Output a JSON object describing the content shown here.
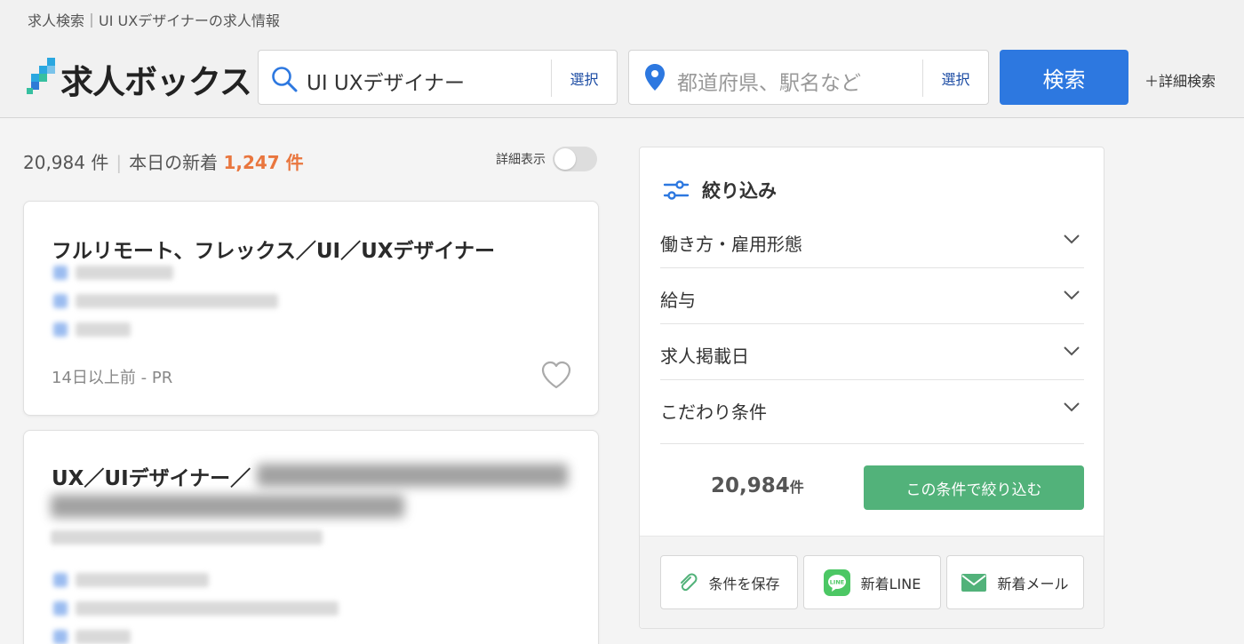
{
  "breadcrumb": "求人検索｜UI UXデザイナーの求人情報",
  "logo": {
    "text": "求人ボックス"
  },
  "search": {
    "keyword_value": "UI UXデザイナー",
    "keyword_select": "選択",
    "location_placeholder": "都道府県、駅名など",
    "location_select": "選択",
    "submit": "検索",
    "advanced": "＋詳細検索"
  },
  "results": {
    "total": "20,984 件",
    "separator": "|",
    "new_label": "本日の新着",
    "new_count": "1,247 件",
    "detail_toggle_label": "詳細表示"
  },
  "jobs": [
    {
      "title": "フルリモート、フレックス／UI／UXデザイナー",
      "meta": "14日以上前 - PR"
    },
    {
      "title": "UX／UIデザイナー／"
    }
  ],
  "filter": {
    "title": "絞り込み",
    "rows": [
      {
        "label": "働き方・雇用形態"
      },
      {
        "label": "給与"
      },
      {
        "label": "求人掲載日"
      },
      {
        "label": "こだわり条件"
      }
    ],
    "count_num": "20,984",
    "count_unit": "件",
    "apply": "この条件で絞り込む",
    "save": "条件を保存",
    "line": "新着LINE",
    "mail": "新着メール"
  },
  "colors": {
    "accent_blue": "#2d78e0",
    "new_orange": "#e9763e",
    "apply_green": "#52b27a",
    "line_green": "#4cc764"
  }
}
